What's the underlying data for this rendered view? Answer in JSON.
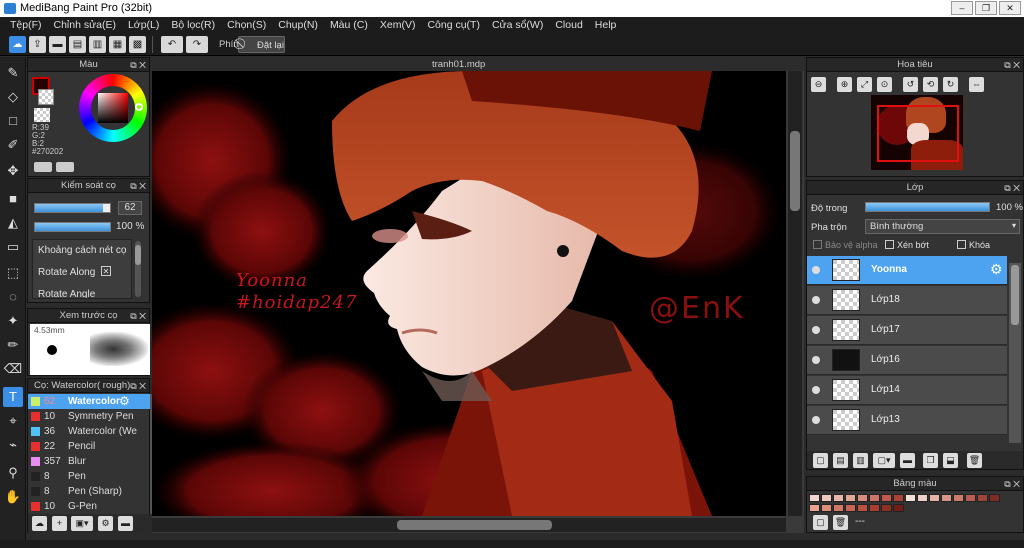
{
  "window": {
    "title": "MediBang Paint Pro (32bit)",
    "min": "–",
    "max": "❐",
    "close": "✕"
  },
  "menu": [
    "Tệp(F)",
    "Chỉnh sửa(E)",
    "Lớp(L)",
    "Bộ lọc(R)",
    "Chọn(S)",
    "Chụp(N)",
    "Màu (C)",
    "Xem(V)",
    "Công cụ(T)",
    "Cửa sổ(W)",
    "Cloud",
    "Help"
  ],
  "toolbar": {
    "hotkey_label": "Phím",
    "reset_label": "Đặt lại"
  },
  "color_panel": {
    "title": "Màu",
    "r": "R:39",
    "g": "G:2",
    "b": "B:2",
    "hex": "#270202",
    "primary": "#270202"
  },
  "brush_control": {
    "title": "Kiểm soát cọ",
    "size": "62",
    "opacity": "100 %",
    "size_fill": 0.9,
    "opacity_fill": 1.0,
    "item1": "Khoảng cách nét cọ",
    "item2": "Rotate Along",
    "item3": "Rotate Angle"
  },
  "brush_preview": {
    "title": "Xem trước cọ",
    "size": "4.53mm"
  },
  "brush_list": {
    "title": "Cọ: Watercolor( rough)",
    "items": [
      {
        "size": "62",
        "name": "Watercolor",
        "color": "#c8ee6a"
      },
      {
        "size": "10",
        "name": "Symmetry Pen",
        "color": "#e63030"
      },
      {
        "size": "36",
        "name": "Watercolor (We",
        "color": "#4fc3f7"
      },
      {
        "size": "22",
        "name": "Pencil",
        "color": "#e63030"
      },
      {
        "size": "357",
        "name": "Blur",
        "color": "#e88ef0"
      },
      {
        "size": "8",
        "name": "Pen",
        "color": "#222222"
      },
      {
        "size": "8",
        "name": "Pen (Sharp)",
        "color": "#222222"
      },
      {
        "size": "10",
        "name": "G-Pen",
        "color": "#e63030"
      }
    ]
  },
  "canvas": {
    "tab": "tranh01.mdp",
    "text1": "Yoonna",
    "text2": "#hoidap247",
    "signature": "@EnK"
  },
  "navigator": {
    "title": "Hoa tiêu"
  },
  "layers_panel": {
    "title": "Lớp",
    "opacity_label": "Độ trong",
    "opacity_value": "100 %",
    "opacity_fill": 1.0,
    "blend_label": "Pha trộn",
    "blend_value": "Bình thường",
    "protect_alpha": "Bảo vệ alpha",
    "clip": "Xén bớt",
    "lock": "Khóa",
    "layers": [
      "Yoonna",
      "Lớp18",
      "Lớp17",
      "Lớp16",
      "Lớp14",
      "Lớp13"
    ]
  },
  "palette": {
    "title": "Bảng màu",
    "extra": "---",
    "colors": [
      "#f3d6cf",
      "#efc9c0",
      "#e8b7ab",
      "#e2a898",
      "#d88c7e",
      "#cf7567",
      "#c15a4d",
      "#a94338",
      "#f6e0da",
      "#f0d0c6",
      "#e5b3a6",
      "#d99585",
      "#cc7a6a",
      "#b85d4f",
      "#9e4438",
      "#7f2d24",
      "#e9a28f",
      "#dd8d78",
      "#d47a64",
      "#c96552",
      "#bb5140",
      "#a73f31",
      "#8e2f24",
      "#6f1f17"
    ]
  }
}
